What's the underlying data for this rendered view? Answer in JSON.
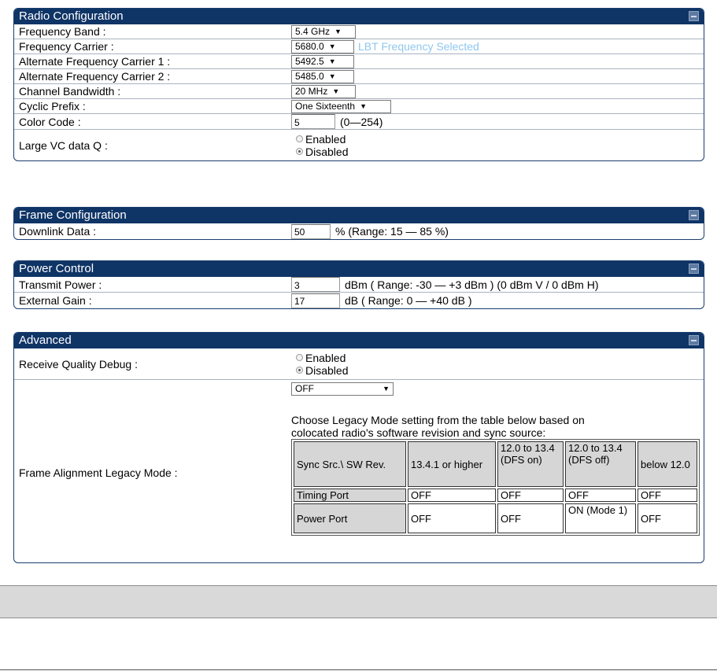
{
  "radio": {
    "title": "Radio Configuration",
    "frequency_band": {
      "label": "Frequency Band :",
      "value": "5.4 GHz"
    },
    "frequency_carrier": {
      "label": "Frequency Carrier :",
      "value": "5680.0",
      "note": "LBT Frequency Selected"
    },
    "alt_carrier_1": {
      "label": "Alternate Frequency Carrier 1 :",
      "value": "5492.5"
    },
    "alt_carrier_2": {
      "label": "Alternate Frequency Carrier 2 :",
      "value": "5485.0"
    },
    "channel_bandwidth": {
      "label": "Channel Bandwidth :",
      "value": "20 MHz"
    },
    "cyclic_prefix": {
      "label": "Cyclic Prefix :",
      "value": "One Sixteenth"
    },
    "color_code": {
      "label": "Color Code :",
      "value": "5",
      "range": "(0—254)"
    },
    "large_vc": {
      "label": "Large VC data Q :",
      "enabled": "Enabled",
      "disabled": "Disabled",
      "selected": "Disabled"
    }
  },
  "frame": {
    "title": "Frame Configuration",
    "downlink": {
      "label": "Downlink Data :",
      "value": "50",
      "range": "% (Range: 15 — 85 %)"
    }
  },
  "power": {
    "title": "Power Control",
    "transmit": {
      "label": "Transmit Power :",
      "value": "3",
      "range": "dBm ( Range: -30 — +3 dBm ) (0 dBm V / 0 dBm H)"
    },
    "gain": {
      "label": "External Gain :",
      "value": "17",
      "range": "dB ( Range: 0 — +40 dB )"
    }
  },
  "advanced": {
    "title": "Advanced",
    "rq_debug": {
      "label": "Receive Quality Debug :",
      "enabled": "Enabled",
      "disabled": "Disabled",
      "selected": "Disabled"
    },
    "legacy": {
      "label": "Frame Alignment Legacy Mode :",
      "value": "OFF",
      "help_1": "Choose Legacy Mode setting from the table below based on",
      "help_2": "colocated radio's software revision and sync source:",
      "table": {
        "headers": [
          "Sync Src.\\ SW Rev.",
          "13.4.1 or higher",
          "12.0 to 13.4 (DFS on)",
          "12.0 to 13.4 (DFS off)",
          "below 12.0"
        ],
        "rows": [
          [
            "Timing Port",
            "OFF",
            "OFF",
            "OFF",
            "OFF"
          ],
          [
            "Power Port",
            "OFF",
            "OFF",
            "ON (Mode 1)",
            "OFF"
          ]
        ]
      }
    }
  },
  "icons": {
    "collapse": "collapse-icon",
    "dropdown": "chevron-down-icon",
    "radio": "radio-button-icon"
  }
}
